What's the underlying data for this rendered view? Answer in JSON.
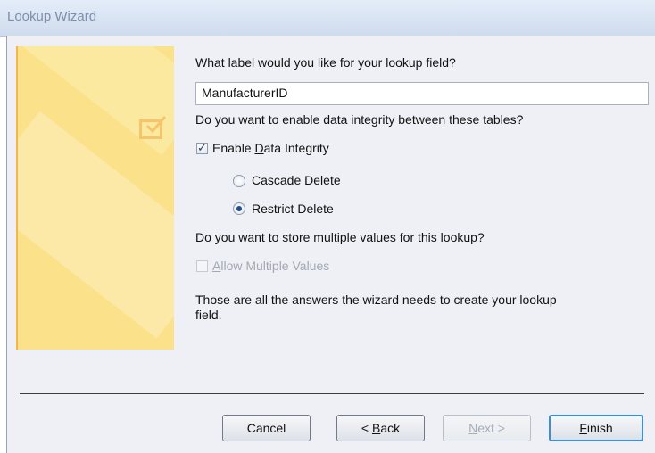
{
  "window": {
    "title": "Lookup Wizard"
  },
  "wizard": {
    "question_label": "What label would you like for your lookup field?",
    "field_value": "ManufacturerID",
    "integrity_question": "Do you want to enable data integrity between these tables?",
    "enable_integrity_label_pre": "Enable ",
    "enable_integrity_label_accel": "D",
    "enable_integrity_label_post": "ata Integrity",
    "enable_integrity_checked": true,
    "cascade_delete_label": "Cascade Delete",
    "restrict_delete_label": "Restrict Delete",
    "delete_option_selected": "Restrict Delete",
    "multiple_values_question": "Do you want to store multiple values for this lookup?",
    "allow_multiple_label_accel": "A",
    "allow_multiple_label_post": "llow Multiple Values",
    "allow_multiple_checked": false,
    "final_text_line1": "Those are all the answers the wizard needs to create your lookup",
    "final_text_line2": "field."
  },
  "buttons": {
    "cancel": "Cancel",
    "back_pre": "< ",
    "back_accel": "B",
    "back_post": "ack",
    "next_accel": "N",
    "next_post": "ext >",
    "finish_accel": "F",
    "finish_post": "inish"
  },
  "colors": {
    "banner": "#fbe28a",
    "banner_edge": "#f2b74a",
    "accent": "#3c8fd6"
  }
}
